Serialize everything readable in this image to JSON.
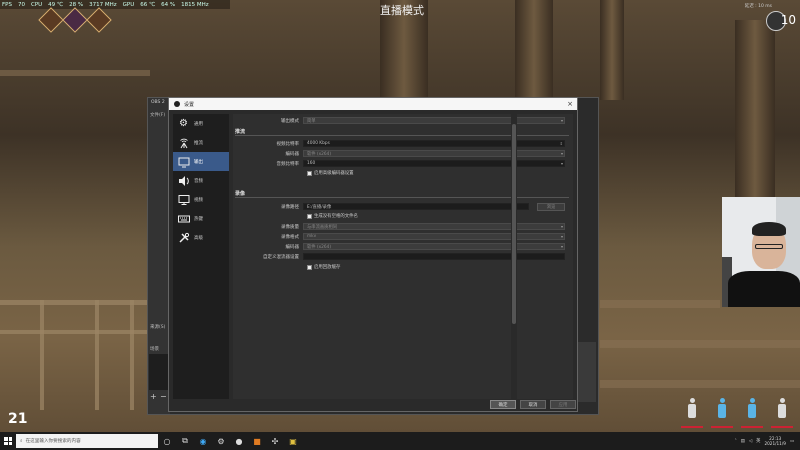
{
  "hud": {
    "fps_label": "FPS",
    "fps_value": "70",
    "cpu_label": "CPU",
    "cpu_temp": "49 ℃",
    "cpu_load": "28 %",
    "cpu_clock": "3717 MHz",
    "gpu_label": "GPU",
    "gpu_temp": "66 ℃",
    "gpu_load": "64 %",
    "gpu_clock": "1815 MHz"
  },
  "stream_title": "直播模式",
  "top_right_text": "延迟 : 10 ms",
  "badge_number": "10",
  "obs_back": {
    "title": "OBS 2",
    "side_labels": [
      "文件(F)",
      "来源(S)",
      "场景"
    ],
    "add_icon": "+",
    "remove_icon": "−"
  },
  "settings": {
    "title": "设置",
    "close_icon": "×",
    "nav": [
      {
        "label": "通用",
        "icon": "gear-icon"
      },
      {
        "label": "推流",
        "icon": "antenna-icon"
      },
      {
        "label": "输出",
        "icon": "monitor-output-icon"
      },
      {
        "label": "音频",
        "icon": "speaker-icon"
      },
      {
        "label": "视频",
        "icon": "display-icon"
      },
      {
        "label": "热键",
        "icon": "keyboard-icon"
      },
      {
        "label": "高级",
        "icon": "tools-icon"
      }
    ],
    "active_nav": 2,
    "output_mode_label": "输出模式",
    "output_mode_value": "简单",
    "streaming_section": "推流",
    "video_bitrate_label": "视频比特率",
    "video_bitrate_value": "4000 Kbps",
    "encoder_label": "编码器",
    "encoder_value": "软件 (x264)",
    "audio_bitrate_label": "音频比特率",
    "audio_bitrate_value": "160",
    "advanced_encoder_label": "启用高级编码器设置",
    "recording_section": "录像",
    "recording_path_label": "录像路径",
    "recording_path_value": "E:/直播/录像",
    "browse_label": "浏览",
    "no_space_label": "生成没有空格的文件名",
    "recording_quality_label": "录像质量",
    "recording_quality_value": "与串流画质相同",
    "recording_format_label": "录像格式",
    "recording_format_value": "mkv",
    "rec_encoder_label": "编码器",
    "rec_encoder_value": "软件 (x264)",
    "muxer_label": "自定义混流器设置",
    "replay_buffer_label": "启用回放缓存",
    "ok_label": "确定",
    "cancel_label": "取消",
    "apply_label": "应用"
  },
  "score_number": "21",
  "taskbar": {
    "search_placeholder": "在这里输入你要搜索的内容",
    "tray_lang": "英",
    "time": "22:13",
    "date": "2021/11/9"
  }
}
